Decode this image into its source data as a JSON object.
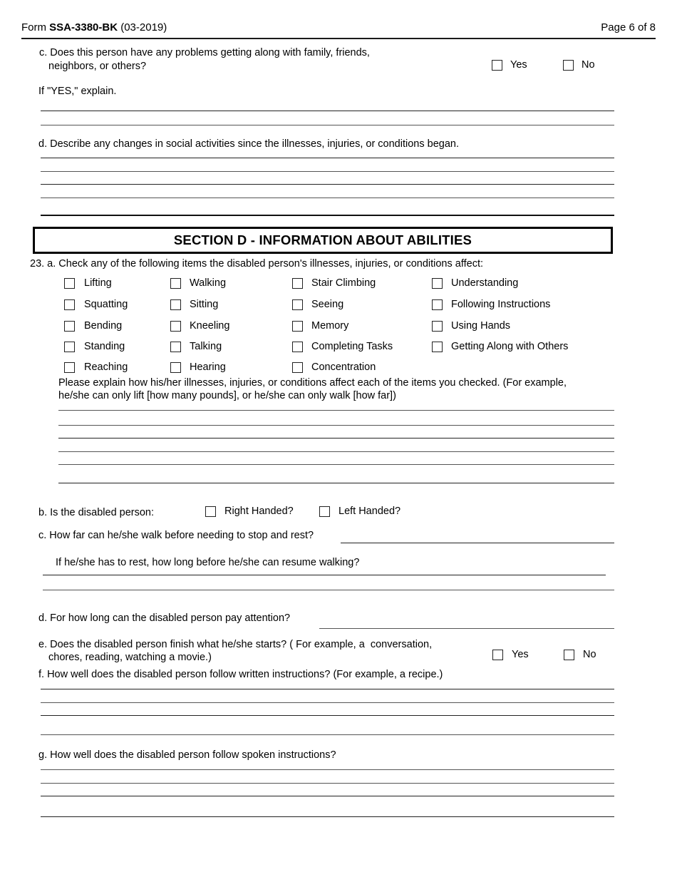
{
  "header": {
    "form_prefix": "Form ",
    "form_number": "SSA-3380-BK",
    "form_revision": " (03-2019)",
    "page_label": "Page 6 of 8"
  },
  "question_22": {
    "c_line1": "c. Does this person have any problems getting along with family, friends,",
    "c_line2": "neighbors, or others?",
    "c_yes": "Yes",
    "c_no": "No",
    "if_yes_explain": "If \"YES,\" explain.",
    "d_text": "d. Describe any changes in social activities since the illnesses, injuries, or conditions began."
  },
  "section_d": {
    "title": "SECTION D - INFORMATION ABOUT ABILITIES"
  },
  "question_23": {
    "a_prompt": "23. a. Check any of the following items the disabled person's illnesses, injuries, or conditions affect:",
    "checkbox_columns": [
      [
        "Lifting",
        "Squatting",
        "Bending",
        "Standing",
        "Reaching"
      ],
      [
        "Walking",
        "Sitting",
        "Kneeling",
        "Talking",
        "Hearing"
      ],
      [
        "Stair Climbing",
        "Seeing",
        "Memory",
        "Completing Tasks",
        "Concentration"
      ],
      [
        "Understanding",
        "Following Instructions",
        "Using Hands",
        "Getting Along with Others"
      ]
    ],
    "explain_line1": "Please explain how his/her illnesses, injuries, or conditions affect each of the items you checked. (For example,",
    "explain_line2": "he/she can only lift [how many pounds], or he/she can only walk [how far])",
    "b_label": "b. Is the disabled person:",
    "b_right_handed": "Right Handed?",
    "b_left_handed": "Left Handed?",
    "c_text": "c. How far can he/she walk before needing to stop and rest?",
    "c_sub_text": "If he/she has to rest, how long before he/she can resume walking?",
    "d_text": "d. For how long can the disabled person pay attention?",
    "e_line1": "e. Does the disabled person finish what he/she starts? ( For example, a  conversation,",
    "e_line2": "chores, reading, watching a movie.)",
    "e_yes": "Yes",
    "e_no": "No",
    "f_text": "f. How well does the disabled person follow written instructions? (For example, a recipe.)",
    "g_text": "g. How well does the disabled person follow spoken instructions?"
  }
}
